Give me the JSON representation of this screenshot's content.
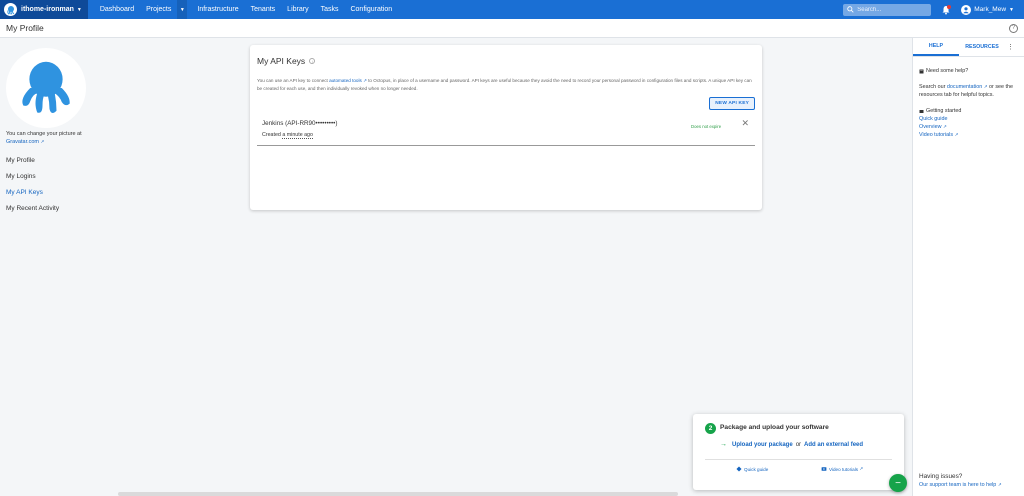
{
  "topnav": {
    "space_name": "ithome-ironman",
    "items": [
      "Dashboard",
      "Projects",
      "Infrastructure",
      "Tenants",
      "Library",
      "Tasks",
      "Configuration"
    ],
    "search_placeholder": "Search...",
    "user_name": "Mark_Mew",
    "bar_color": "#1a6fd4",
    "space_color": "#0e4a99"
  },
  "header": {
    "title": "My Profile"
  },
  "left": {
    "gravatar_text": "You can change your picture at",
    "gravatar_link": "Gravatar.com",
    "nav": [
      "My Profile",
      "My Logins",
      "My API Keys",
      "My Recent Activity"
    ],
    "active_index": 2
  },
  "card": {
    "title": "My API Keys",
    "desc_prefix": "You can use an API key to connect ",
    "desc_link": "automated tools",
    "desc_suffix": " to Octopus, in place of a username and password. API keys are useful because they avoid the need to record your personal password in configuration files and scripts. A unique API key can be created for each use, and then individually revoked when no longer needed.",
    "new_button": "NEW API KEY",
    "key": {
      "name": "Jenkins (API-RR90•••••••••)",
      "created_prefix": "Created ",
      "created_ago": "a minute ago",
      "expiry": "Does not expire"
    }
  },
  "help_panel": {
    "tab_help": "HELP",
    "tab_resources": "RESOURCES",
    "need_help": "Need some help?",
    "search_prefix": "Search our ",
    "search_link": "documentation",
    "search_suffix": " or see the resources tab for helpful topics.",
    "getting_started": "Getting started",
    "links": [
      "Quick guide",
      "Overview",
      "Video tutorials"
    ],
    "issues_title": "Having issues?",
    "issues_link": "Our support team is here to help"
  },
  "onboarding": {
    "step": "2",
    "title": "Package and upload your software",
    "action_upload": "Upload your package",
    "action_or": "or",
    "action_feed": "Add an external feed",
    "quick_guide": "Quick guide",
    "video_tutorials": "Video tutorials",
    "fab_symbol": "−",
    "accent_color": "#16a34a"
  }
}
